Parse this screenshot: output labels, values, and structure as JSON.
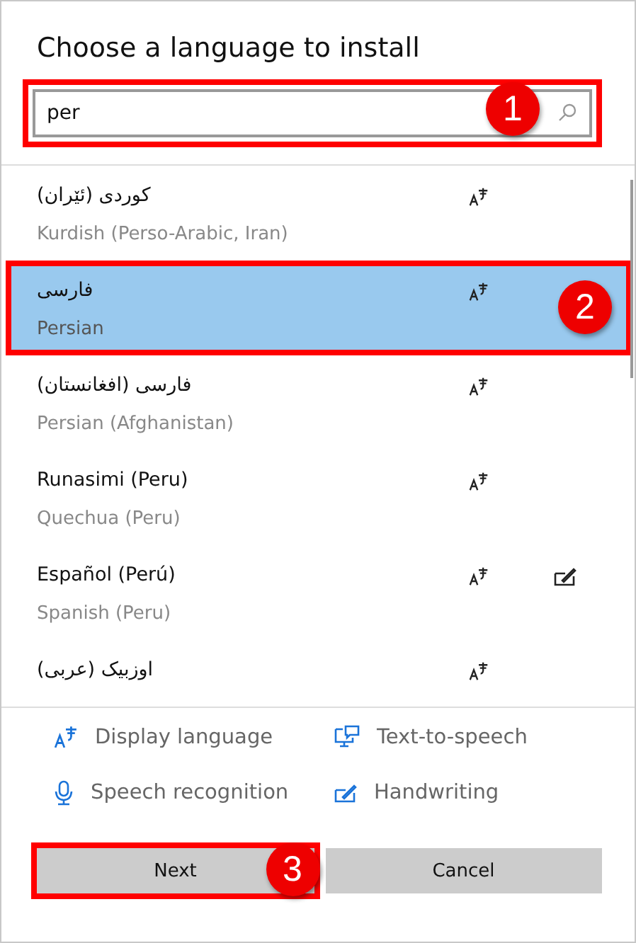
{
  "dialog": {
    "title": "Choose a language to install"
  },
  "search": {
    "value": "per",
    "callout": "1"
  },
  "languages": [
    {
      "native": "کوردی (ئێران)",
      "english": "Kurdish (Perso-Arabic, Iran)",
      "display": true,
      "handwriting": false,
      "selected": false
    },
    {
      "native": "فارسی",
      "english": "Persian",
      "display": true,
      "handwriting": false,
      "selected": true,
      "callout": "2"
    },
    {
      "native": "فارسی (افغانستان)",
      "english": "Persian (Afghanistan)",
      "display": true,
      "handwriting": false,
      "selected": false
    },
    {
      "native": "Runasimi (Peru)",
      "english": "Quechua (Peru)",
      "display": true,
      "handwriting": false,
      "selected": false
    },
    {
      "native": "Español (Perú)",
      "english": "Spanish (Peru)",
      "display": true,
      "handwriting": true,
      "selected": false
    },
    {
      "native": "اوزبیک (عربی)",
      "display": true,
      "handwriting": false,
      "selected": false
    }
  ],
  "legend": [
    {
      "kind": "display",
      "label": "Display language"
    },
    {
      "kind": "tts",
      "label": "Text-to-speech"
    },
    {
      "kind": "speech",
      "label": "Speech recognition"
    },
    {
      "kind": "handwriting",
      "label": "Handwriting"
    }
  ],
  "buttons": [
    {
      "label": "Next",
      "callout": "3"
    },
    {
      "label": "Cancel"
    }
  ]
}
